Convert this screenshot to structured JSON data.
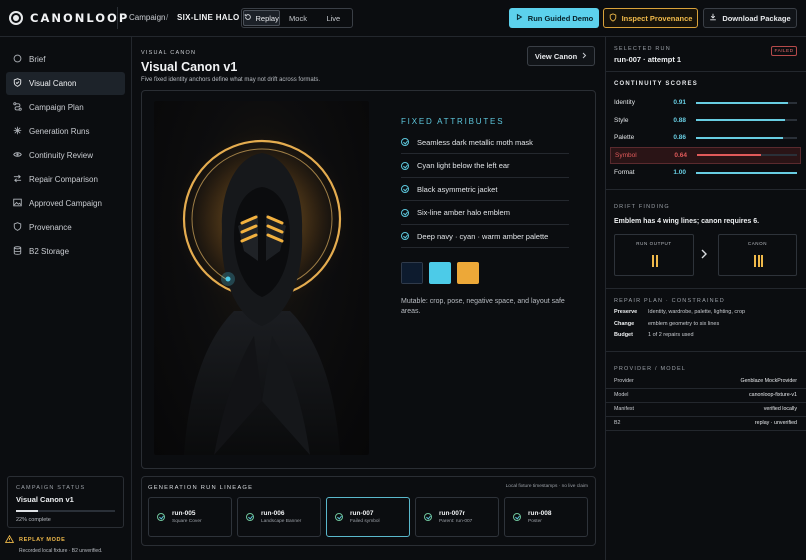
{
  "app": {
    "name": "CANONLOOP"
  },
  "header": {
    "crumb_campaign": "Campaign",
    "crumb_current": "SIX-LINE HALO",
    "modes": [
      "Replay",
      "Mock",
      "Live"
    ],
    "run_guided": "Run Guided Demo",
    "inspect": "Inspect Provenance",
    "download": "Download Package"
  },
  "sidebar": {
    "items": [
      {
        "label": "Brief",
        "icon": "circle-icon"
      },
      {
        "label": "Visual Canon",
        "icon": "shield-check-icon"
      },
      {
        "label": "Campaign Plan",
        "icon": "route-icon"
      },
      {
        "label": "Generation Runs",
        "icon": "sparkle-icon"
      },
      {
        "label": "Continuity Review",
        "icon": "eye-icon"
      },
      {
        "label": "Repair Comparison",
        "icon": "arrows-icon"
      },
      {
        "label": "Approved Campaign",
        "icon": "image-icon"
      },
      {
        "label": "Provenance",
        "icon": "shield-icon"
      },
      {
        "label": "B2 Storage",
        "icon": "database-icon"
      }
    ],
    "status": {
      "label": "CAMPAIGN STATUS",
      "title": "Visual Canon v1",
      "progress": 0.22,
      "progress_text": "22% complete"
    },
    "replay": {
      "title": "REPLAY MODE",
      "text": "Recorded local fixture · B2 unverified."
    }
  },
  "main": {
    "eyebrow": "VISUAL CANON",
    "title": "Visual Canon v1",
    "subtitle": "Five fixed identity anchors define what may not drift across formats.",
    "view_canon": "View Canon",
    "fixed_title": "FIXED ATTRIBUTES",
    "attributes": [
      "Seamless dark metallic moth mask",
      "Cyan light below the left ear",
      "Black asymmetric jacket",
      "Six-line amber halo emblem",
      "Deep navy · cyan · warm amber palette"
    ],
    "palette": [
      "#0d1b2e",
      "#4ccbe8",
      "#eda838"
    ],
    "mutable": "Mutable: crop, pose, negative space, and layout safe areas."
  },
  "lineage": {
    "title": "GENERATION RUN LINEAGE",
    "note": "Local fixture timestamps · no live claim",
    "runs": [
      {
        "id": "run-005",
        "sub": "Square Cover"
      },
      {
        "id": "run-006",
        "sub": "Landscape Banner"
      },
      {
        "id": "run-007",
        "sub": "Failed symbol"
      },
      {
        "id": "run-007r",
        "sub": "Parent: run-007"
      },
      {
        "id": "run-008",
        "sub": "Poster"
      }
    ]
  },
  "right": {
    "selected_label": "SELECTED RUN",
    "selected_run": "run-007 · attempt 1",
    "failed_badge": "FAILED",
    "scores_title": "CONTINUITY SCORES",
    "scores": [
      {
        "label": "Identity",
        "value": "0.91",
        "v": 0.91
      },
      {
        "label": "Style",
        "value": "0.88",
        "v": 0.88
      },
      {
        "label": "Palette",
        "value": "0.86",
        "v": 0.86
      },
      {
        "label": "Symbol",
        "value": "0.64",
        "v": 0.64
      },
      {
        "label": "Format",
        "value": "1.00",
        "v": 1.0
      }
    ],
    "drift_label": "DRIFT FINDING",
    "drift_text": "Emblem has 4 wing lines; canon requires 6.",
    "run_output": "RUN OUTPUT",
    "canon": "CANON",
    "repair_label": "REPAIR PLAN · CONSTRAINED",
    "repair": [
      {
        "k": "Preserve",
        "v": "Identity, wardrobe, palette, lighting, crop"
      },
      {
        "k": "Change",
        "v": "emblem geometry to six lines"
      },
      {
        "k": "Budget",
        "v": "1 of 2 repairs used"
      }
    ],
    "provider_label": "PROVIDER / MODEL",
    "provider": [
      {
        "k": "Provider",
        "v": "Genblaze MockProvider"
      },
      {
        "k": "Model",
        "v": "canonloop-fixture-v1"
      },
      {
        "k": "Manifest",
        "v": "verified locally"
      },
      {
        "k": "B2",
        "v": "replay · unverified"
      }
    ],
    "colors": {
      "accent": "#68cde2",
      "fail": "#e05a5a",
      "amber": "#efb94a"
    }
  }
}
